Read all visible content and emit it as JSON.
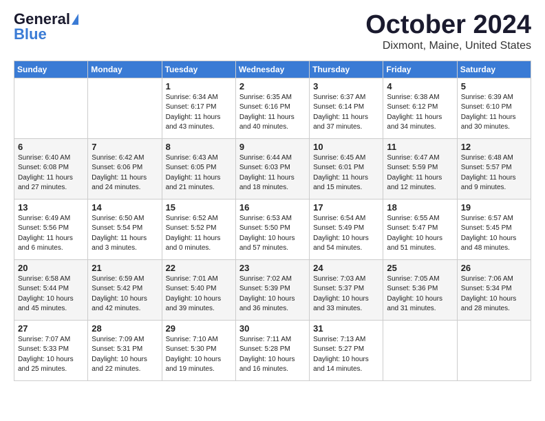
{
  "logo": {
    "line1": "General",
    "line2": "Blue"
  },
  "title": "October 2024",
  "location": "Dixmont, Maine, United States",
  "headers": [
    "Sunday",
    "Monday",
    "Tuesday",
    "Wednesday",
    "Thursday",
    "Friday",
    "Saturday"
  ],
  "weeks": [
    [
      {
        "day": "",
        "info": ""
      },
      {
        "day": "",
        "info": ""
      },
      {
        "day": "1",
        "info": "Sunrise: 6:34 AM\nSunset: 6:17 PM\nDaylight: 11 hours\nand 43 minutes."
      },
      {
        "day": "2",
        "info": "Sunrise: 6:35 AM\nSunset: 6:16 PM\nDaylight: 11 hours\nand 40 minutes."
      },
      {
        "day": "3",
        "info": "Sunrise: 6:37 AM\nSunset: 6:14 PM\nDaylight: 11 hours\nand 37 minutes."
      },
      {
        "day": "4",
        "info": "Sunrise: 6:38 AM\nSunset: 6:12 PM\nDaylight: 11 hours\nand 34 minutes."
      },
      {
        "day": "5",
        "info": "Sunrise: 6:39 AM\nSunset: 6:10 PM\nDaylight: 11 hours\nand 30 minutes."
      }
    ],
    [
      {
        "day": "6",
        "info": "Sunrise: 6:40 AM\nSunset: 6:08 PM\nDaylight: 11 hours\nand 27 minutes."
      },
      {
        "day": "7",
        "info": "Sunrise: 6:42 AM\nSunset: 6:06 PM\nDaylight: 11 hours\nand 24 minutes."
      },
      {
        "day": "8",
        "info": "Sunrise: 6:43 AM\nSunset: 6:05 PM\nDaylight: 11 hours\nand 21 minutes."
      },
      {
        "day": "9",
        "info": "Sunrise: 6:44 AM\nSunset: 6:03 PM\nDaylight: 11 hours\nand 18 minutes."
      },
      {
        "day": "10",
        "info": "Sunrise: 6:45 AM\nSunset: 6:01 PM\nDaylight: 11 hours\nand 15 minutes."
      },
      {
        "day": "11",
        "info": "Sunrise: 6:47 AM\nSunset: 5:59 PM\nDaylight: 11 hours\nand 12 minutes."
      },
      {
        "day": "12",
        "info": "Sunrise: 6:48 AM\nSunset: 5:57 PM\nDaylight: 11 hours\nand 9 minutes."
      }
    ],
    [
      {
        "day": "13",
        "info": "Sunrise: 6:49 AM\nSunset: 5:56 PM\nDaylight: 11 hours\nand 6 minutes."
      },
      {
        "day": "14",
        "info": "Sunrise: 6:50 AM\nSunset: 5:54 PM\nDaylight: 11 hours\nand 3 minutes."
      },
      {
        "day": "15",
        "info": "Sunrise: 6:52 AM\nSunset: 5:52 PM\nDaylight: 11 hours\nand 0 minutes."
      },
      {
        "day": "16",
        "info": "Sunrise: 6:53 AM\nSunset: 5:50 PM\nDaylight: 10 hours\nand 57 minutes."
      },
      {
        "day": "17",
        "info": "Sunrise: 6:54 AM\nSunset: 5:49 PM\nDaylight: 10 hours\nand 54 minutes."
      },
      {
        "day": "18",
        "info": "Sunrise: 6:55 AM\nSunset: 5:47 PM\nDaylight: 10 hours\nand 51 minutes."
      },
      {
        "day": "19",
        "info": "Sunrise: 6:57 AM\nSunset: 5:45 PM\nDaylight: 10 hours\nand 48 minutes."
      }
    ],
    [
      {
        "day": "20",
        "info": "Sunrise: 6:58 AM\nSunset: 5:44 PM\nDaylight: 10 hours\nand 45 minutes."
      },
      {
        "day": "21",
        "info": "Sunrise: 6:59 AM\nSunset: 5:42 PM\nDaylight: 10 hours\nand 42 minutes."
      },
      {
        "day": "22",
        "info": "Sunrise: 7:01 AM\nSunset: 5:40 PM\nDaylight: 10 hours\nand 39 minutes."
      },
      {
        "day": "23",
        "info": "Sunrise: 7:02 AM\nSunset: 5:39 PM\nDaylight: 10 hours\nand 36 minutes."
      },
      {
        "day": "24",
        "info": "Sunrise: 7:03 AM\nSunset: 5:37 PM\nDaylight: 10 hours\nand 33 minutes."
      },
      {
        "day": "25",
        "info": "Sunrise: 7:05 AM\nSunset: 5:36 PM\nDaylight: 10 hours\nand 31 minutes."
      },
      {
        "day": "26",
        "info": "Sunrise: 7:06 AM\nSunset: 5:34 PM\nDaylight: 10 hours\nand 28 minutes."
      }
    ],
    [
      {
        "day": "27",
        "info": "Sunrise: 7:07 AM\nSunset: 5:33 PM\nDaylight: 10 hours\nand 25 minutes."
      },
      {
        "day": "28",
        "info": "Sunrise: 7:09 AM\nSunset: 5:31 PM\nDaylight: 10 hours\nand 22 minutes."
      },
      {
        "day": "29",
        "info": "Sunrise: 7:10 AM\nSunset: 5:30 PM\nDaylight: 10 hours\nand 19 minutes."
      },
      {
        "day": "30",
        "info": "Sunrise: 7:11 AM\nSunset: 5:28 PM\nDaylight: 10 hours\nand 16 minutes."
      },
      {
        "day": "31",
        "info": "Sunrise: 7:13 AM\nSunset: 5:27 PM\nDaylight: 10 hours\nand 14 minutes."
      },
      {
        "day": "",
        "info": ""
      },
      {
        "day": "",
        "info": ""
      }
    ]
  ]
}
